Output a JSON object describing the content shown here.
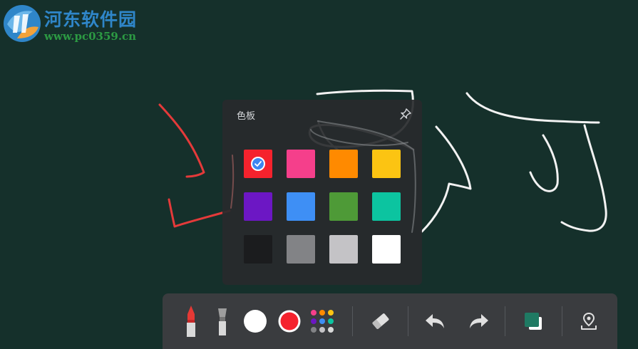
{
  "watermark": {
    "title": "河东软件园",
    "url": "www.pc0359.cn"
  },
  "palette": {
    "title": "色板",
    "selected_color": "#f5222d",
    "colors": [
      "#f5222d",
      "#f53f8b",
      "#ff8a00",
      "#fcc412",
      "#6c17c4",
      "#3e8ff5",
      "#4e9a37",
      "#0cc4a0",
      "#1b1c1e",
      "#828386",
      "#c4c3c6",
      "#ffffff"
    ]
  },
  "toolbar": {
    "tools": [
      "pen-icon",
      "brush-icon",
      "stroke-size-icon",
      "current-color-icon",
      "color-palette-icon",
      "eraser-icon",
      "undo-icon",
      "redo-icon",
      "background-color-icon",
      "locate-icon"
    ],
    "current_color": "#f5222d",
    "background_color": "#1f7a63",
    "accent": "#e53935"
  }
}
